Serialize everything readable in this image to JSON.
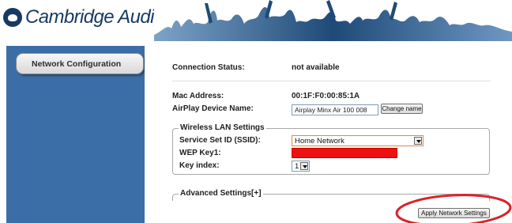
{
  "brand": {
    "name": "Cambridge Audio",
    "color": "#173a63"
  },
  "sidebar": {
    "background": "#3b6ea6",
    "items": [
      {
        "label": "Network Configuration"
      }
    ]
  },
  "status": {
    "connection_label": "Connection Status:",
    "connection_value": "not available"
  },
  "device": {
    "mac_label": "Mac Address:",
    "mac_value": "00:1F:F0:00:85:1A",
    "airplay_label": "AirPlay Device Name:",
    "airplay_value": "Airplay  Minx Air 100  008",
    "change_name_label": "Change name"
  },
  "wireless": {
    "legend": "Wireless LAN Settings",
    "ssid_label": "Service Set ID (SSID):",
    "ssid_value": "Home Network",
    "wep_label": "WEP Key1:",
    "wep_value": "",
    "key_index_label": "Key index:",
    "key_index_value": "1"
  },
  "advanced": {
    "legend": "Advanced Settings[+]"
  },
  "actions": {
    "apply_label": "Apply Network Settings"
  },
  "colors": {
    "highlight_ring": "#d8232a",
    "wep_field_fill": "#ee1111",
    "ssid_focus_border": "#e08a3c"
  },
  "icons": {
    "logo": "cambridge-audio-logo-icon",
    "header_art": "concert-crowd-silhouette",
    "dropdown": "chevron-down-icon"
  }
}
